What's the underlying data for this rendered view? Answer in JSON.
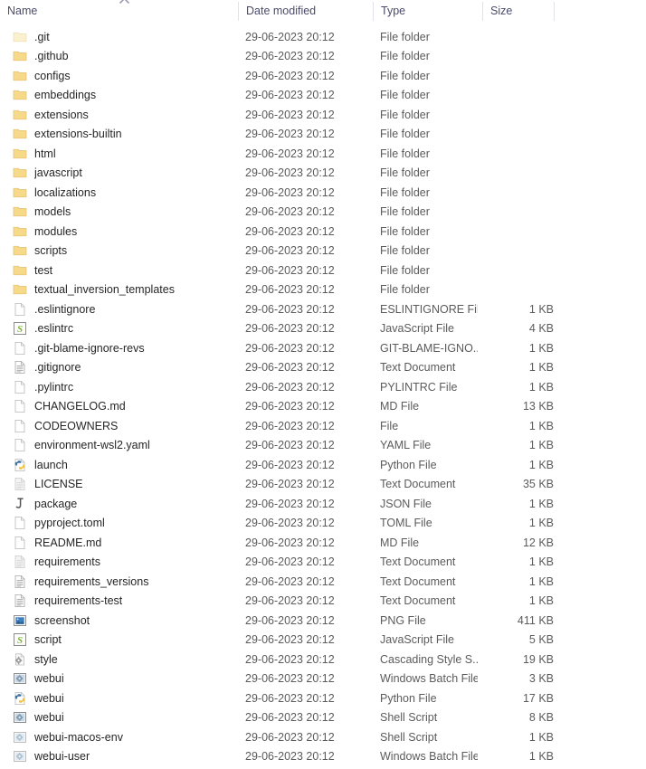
{
  "window": {
    "view": "details"
  },
  "columns": [
    {
      "key": "name",
      "label": "Name",
      "sorted": true,
      "sort_direction": "ascending"
    },
    {
      "key": "date",
      "label": "Date modified"
    },
    {
      "key": "type",
      "label": "Type"
    },
    {
      "key": "size",
      "label": "Size"
    }
  ],
  "icons": {
    "sort_ascending": "chevron-up-icon",
    "folder": "folder-icon",
    "folder_hidden": "folder-hidden-icon",
    "blank_file": "blank-file-icon",
    "text_document": "text-document-icon",
    "text_document_hidden": "text-document-hidden-icon",
    "javascript": "javascript-file-icon",
    "python": "python-file-icon",
    "json": "json-file-icon",
    "png": "png-image-icon",
    "css": "css-file-icon",
    "script": "windows-script-icon",
    "script_hidden": "windows-script-hidden-icon"
  },
  "colors": {
    "folder": "#f7d98a",
    "folder_hidden": "#fbf0cf",
    "header_text": "#4a4a6a",
    "name_text": "#262626",
    "meta_text": "#5b5b5b",
    "divider": "#e2e2ea",
    "background": "#ffffff"
  },
  "rows": [
    {
      "name": ".git",
      "date": "29-06-2023 20:12",
      "type": "File folder",
      "size": "",
      "icon": "folder_hidden"
    },
    {
      "name": ".github",
      "date": "29-06-2023 20:12",
      "type": "File folder",
      "size": "",
      "icon": "folder"
    },
    {
      "name": "configs",
      "date": "29-06-2023 20:12",
      "type": "File folder",
      "size": "",
      "icon": "folder"
    },
    {
      "name": "embeddings",
      "date": "29-06-2023 20:12",
      "type": "File folder",
      "size": "",
      "icon": "folder"
    },
    {
      "name": "extensions",
      "date": "29-06-2023 20:12",
      "type": "File folder",
      "size": "",
      "icon": "folder"
    },
    {
      "name": "extensions-builtin",
      "date": "29-06-2023 20:12",
      "type": "File folder",
      "size": "",
      "icon": "folder"
    },
    {
      "name": "html",
      "date": "29-06-2023 20:12",
      "type": "File folder",
      "size": "",
      "icon": "folder"
    },
    {
      "name": "javascript",
      "date": "29-06-2023 20:12",
      "type": "File folder",
      "size": "",
      "icon": "folder"
    },
    {
      "name": "localizations",
      "date": "29-06-2023 20:12",
      "type": "File folder",
      "size": "",
      "icon": "folder"
    },
    {
      "name": "models",
      "date": "29-06-2023 20:12",
      "type": "File folder",
      "size": "",
      "icon": "folder"
    },
    {
      "name": "modules",
      "date": "29-06-2023 20:12",
      "type": "File folder",
      "size": "",
      "icon": "folder"
    },
    {
      "name": "scripts",
      "date": "29-06-2023 20:12",
      "type": "File folder",
      "size": "",
      "icon": "folder"
    },
    {
      "name": "test",
      "date": "29-06-2023 20:12",
      "type": "File folder",
      "size": "",
      "icon": "folder"
    },
    {
      "name": "textual_inversion_templates",
      "date": "29-06-2023 20:12",
      "type": "File folder",
      "size": "",
      "icon": "folder"
    },
    {
      "name": ".eslintignore",
      "date": "29-06-2023 20:12",
      "type": "ESLINTIGNORE File",
      "size": "1 KB",
      "icon": "blank_file"
    },
    {
      "name": ".eslintrc",
      "date": "29-06-2023 20:12",
      "type": "JavaScript File",
      "size": "4 KB",
      "icon": "javascript"
    },
    {
      "name": ".git-blame-ignore-revs",
      "date": "29-06-2023 20:12",
      "type": "GIT-BLAME-IGNO...",
      "size": "1 KB",
      "icon": "blank_file"
    },
    {
      "name": ".gitignore",
      "date": "29-06-2023 20:12",
      "type": "Text Document",
      "size": "1 KB",
      "icon": "text_document"
    },
    {
      "name": ".pylintrc",
      "date": "29-06-2023 20:12",
      "type": "PYLINTRC File",
      "size": "1 KB",
      "icon": "blank_file"
    },
    {
      "name": "CHANGELOG.md",
      "date": "29-06-2023 20:12",
      "type": "MD File",
      "size": "13 KB",
      "icon": "blank_file"
    },
    {
      "name": "CODEOWNERS",
      "date": "29-06-2023 20:12",
      "type": "File",
      "size": "1 KB",
      "icon": "blank_file"
    },
    {
      "name": "environment-wsl2.yaml",
      "date": "29-06-2023 20:12",
      "type": "YAML File",
      "size": "1 KB",
      "icon": "blank_file"
    },
    {
      "name": "launch",
      "date": "29-06-2023 20:12",
      "type": "Python File",
      "size": "1 KB",
      "icon": "python"
    },
    {
      "name": "LICENSE",
      "date": "29-06-2023 20:12",
      "type": "Text Document",
      "size": "35 KB",
      "icon": "text_document_hidden"
    },
    {
      "name": "package",
      "date": "29-06-2023 20:12",
      "type": "JSON File",
      "size": "1 KB",
      "icon": "json"
    },
    {
      "name": "pyproject.toml",
      "date": "29-06-2023 20:12",
      "type": "TOML File",
      "size": "1 KB",
      "icon": "blank_file"
    },
    {
      "name": "README.md",
      "date": "29-06-2023 20:12",
      "type": "MD File",
      "size": "12 KB",
      "icon": "blank_file"
    },
    {
      "name": "requirements",
      "date": "29-06-2023 20:12",
      "type": "Text Document",
      "size": "1 KB",
      "icon": "text_document_hidden"
    },
    {
      "name": "requirements_versions",
      "date": "29-06-2023 20:12",
      "type": "Text Document",
      "size": "1 KB",
      "icon": "text_document"
    },
    {
      "name": "requirements-test",
      "date": "29-06-2023 20:12",
      "type": "Text Document",
      "size": "1 KB",
      "icon": "text_document"
    },
    {
      "name": "screenshot",
      "date": "29-06-2023 20:12",
      "type": "PNG File",
      "size": "411 KB",
      "icon": "png"
    },
    {
      "name": "script",
      "date": "29-06-2023 20:12",
      "type": "JavaScript File",
      "size": "5 KB",
      "icon": "javascript"
    },
    {
      "name": "style",
      "date": "29-06-2023 20:12",
      "type": "Cascading Style S...",
      "size": "19 KB",
      "icon": "css"
    },
    {
      "name": "webui",
      "date": "29-06-2023 20:12",
      "type": "Windows Batch File",
      "size": "3 KB",
      "icon": "script"
    },
    {
      "name": "webui",
      "date": "29-06-2023 20:12",
      "type": "Python File",
      "size": "17 KB",
      "icon": "python"
    },
    {
      "name": "webui",
      "date": "29-06-2023 20:12",
      "type": "Shell Script",
      "size": "8 KB",
      "icon": "script"
    },
    {
      "name": "webui-macos-env",
      "date": "29-06-2023 20:12",
      "type": "Shell Script",
      "size": "1 KB",
      "icon": "script_hidden"
    },
    {
      "name": "webui-user",
      "date": "29-06-2023 20:12",
      "type": "Windows Batch File",
      "size": "1 KB",
      "icon": "script_hidden"
    }
  ]
}
